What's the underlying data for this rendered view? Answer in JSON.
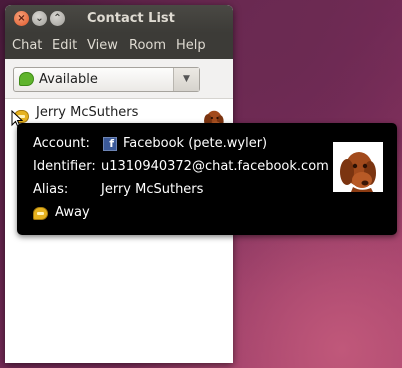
{
  "window": {
    "title": "Contact List",
    "controls": {
      "close": "×",
      "minimize": "⌄",
      "maximize": "⌃"
    }
  },
  "menubar": {
    "items": [
      "Chat",
      "Edit",
      "View",
      "Room",
      "Help"
    ]
  },
  "status": {
    "value": "Available",
    "arrow": "▼",
    "icon": "available-bubble-icon",
    "color": "#5fb42c"
  },
  "contacts": [
    {
      "name": "Jerry McSuthers",
      "status_icon": "away-bubble-icon",
      "avatar": "dog-avatar"
    }
  ],
  "tooltip": {
    "account_label": "Account:",
    "account_icon": "facebook-icon",
    "account_icon_glyph": "f",
    "account_value": "Facebook (pete.wyler)",
    "identifier_label": "Identifier:",
    "identifier_value": "u1310940372@chat.facebook.com",
    "alias_label": "Alias:",
    "alias_value": "Jerry McSuthers",
    "presence_value": "Away",
    "presence_color": "#e6b21f"
  }
}
